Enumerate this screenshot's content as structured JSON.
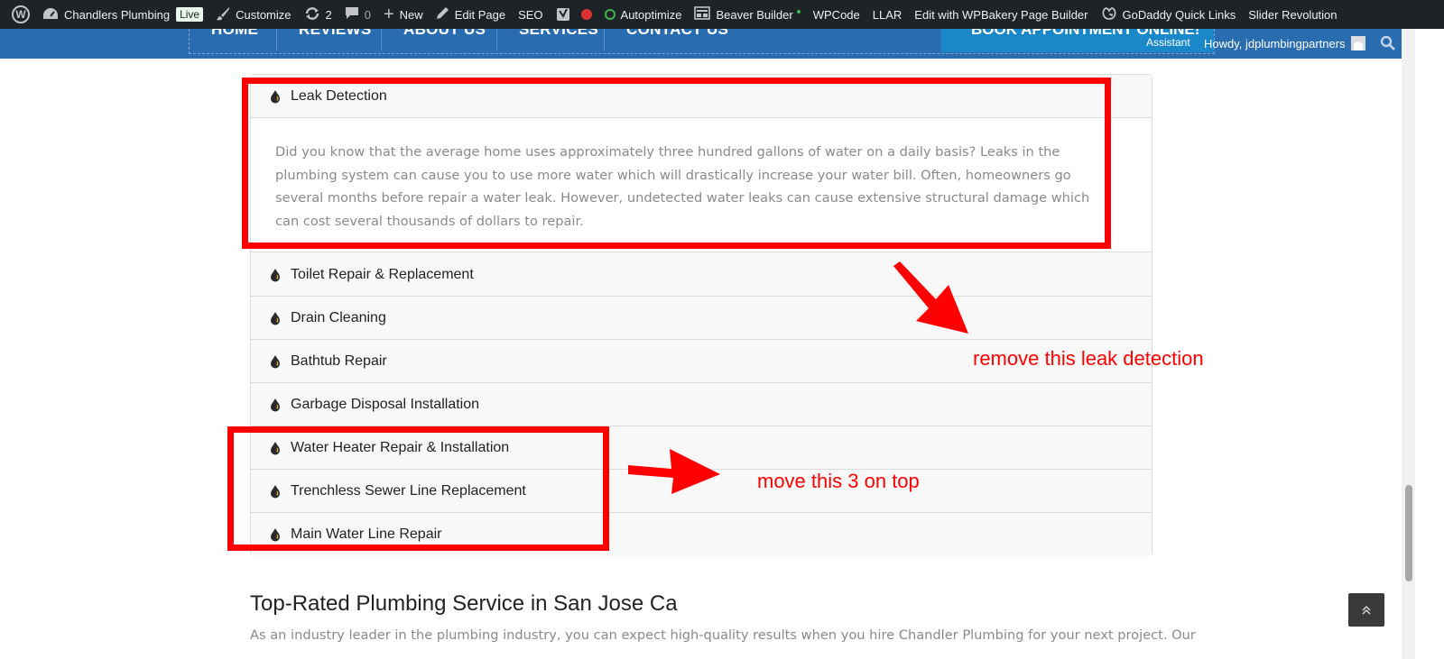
{
  "adminbar": {
    "site_name": "Chandlers Plumbing",
    "live_badge": "Live",
    "customize": "Customize",
    "updates_count": "2",
    "comments_count": "0",
    "new": "New",
    "edit_page": "Edit Page",
    "seo": "SEO",
    "autoptimize": "Autoptimize",
    "beaver_builder": "Beaver Builder",
    "wpcode": "WPCode",
    "llar": "LLAR",
    "wpbakery": "Edit with WPBakery Page Builder",
    "godaddy": "GoDaddy Quick Links",
    "slider_revolution": "Slider Revolution",
    "assistant": "Assistant",
    "howdy": "Howdy, jdplumbingpartners"
  },
  "nav": {
    "items": [
      "HOME",
      "REVIEWS",
      "ABOUT US",
      "SERVICES",
      "CONTACT US"
    ],
    "book_button": "BOOK APPOINTMENT ONLINE!"
  },
  "accordion": {
    "items": [
      {
        "title": "Leak Detection",
        "expanded": true,
        "body": "Did you know that the average home uses approximately three hundred gallons of water on a daily basis? Leaks in the plumbing system can cause you to use more water which will drastically increase your water bill. Often, homeowners go several months before repair a water leak. However, undetected water leaks can cause extensive structural damage which can cost several thousands of dollars to repair."
      },
      {
        "title": "Toilet Repair & Replacement"
      },
      {
        "title": "Drain Cleaning"
      },
      {
        "title": "Bathtub Repair"
      },
      {
        "title": "Garbage Disposal Installation"
      },
      {
        "title": "Water Heater Repair & Installation"
      },
      {
        "title": "Trenchless Sewer Line Replacement"
      },
      {
        "title": "Main Water Line Repair"
      }
    ]
  },
  "annotations": {
    "remove_note": "remove this leak detection",
    "move_note": "move this 3 on top",
    "color": "#ff0000"
  },
  "section": {
    "title": "Top-Rated Plumbing Service in San Jose Ca",
    "text": "As an industry leader in the plumbing industry, you can expect high-quality results when you hire Chandler Plumbing for your next project. Our"
  },
  "colors": {
    "adminbar_bg": "#1d2327",
    "nav_bg": "#2a6cb0",
    "book_bg": "#1a87c9"
  },
  "icons": {
    "accordion_item": "water-drop-icon",
    "back_to_top": "chevron-up-double-icon"
  }
}
